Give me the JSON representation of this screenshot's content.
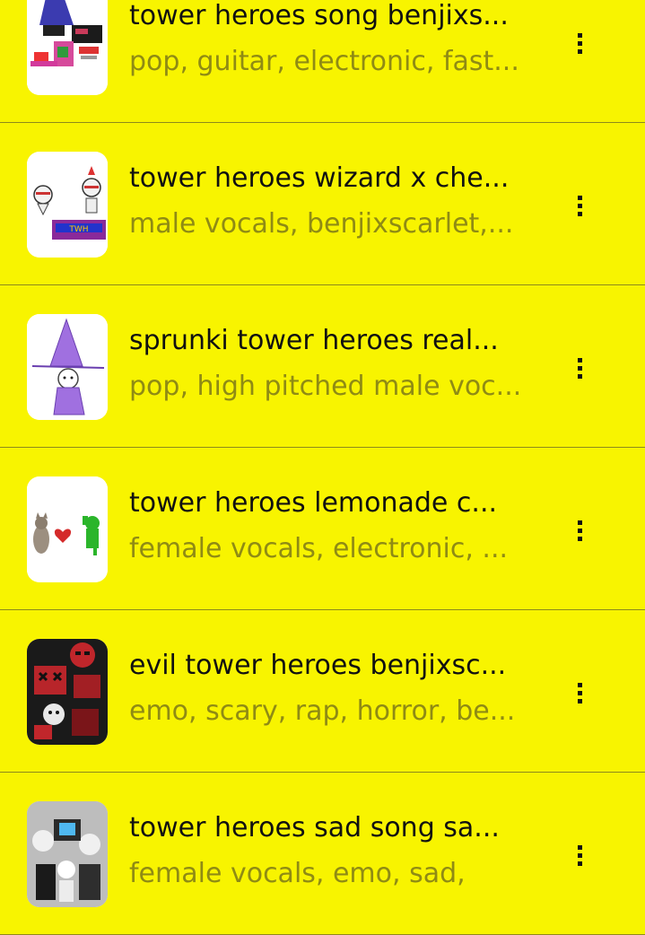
{
  "colors": {
    "background": "#f8f400",
    "title_text": "#111111",
    "tag_text": "#8f8b14",
    "divider": "#8d8a1c"
  },
  "songs": [
    {
      "title": "tower heroes song benjixs...",
      "tags": "pop, guitar, electronic, fast...",
      "thumbnail_icon": "cover-art-wizard-collage",
      "menu_icon": "more-vert-icon"
    },
    {
      "title": "tower heroes wizard x che...",
      "tags": "male vocals, benjixscarlet,...",
      "thumbnail_icon": "cover-art-characters-logo",
      "menu_icon": "more-vert-icon"
    },
    {
      "title": "sprunki tower heroes real...",
      "tags": "pop, high pitched male voc...",
      "thumbnail_icon": "cover-art-purple-wizard",
      "menu_icon": "more-vert-icon"
    },
    {
      "title": "tower heroes lemonade c...",
      "tags": "female vocals, electronic, ...",
      "thumbnail_icon": "cover-art-cat-heart-frog",
      "menu_icon": "more-vert-icon"
    },
    {
      "title": "evil tower heroes benjixsc...",
      "tags": "emo, scary, rap, horror, be...",
      "thumbnail_icon": "cover-art-evil-red",
      "menu_icon": "more-vert-icon"
    },
    {
      "title": "tower heroes sad song sa...",
      "tags": "female vocals, emo, sad,",
      "thumbnail_icon": "cover-art-grayscale-crowd",
      "menu_icon": "more-vert-icon"
    }
  ]
}
